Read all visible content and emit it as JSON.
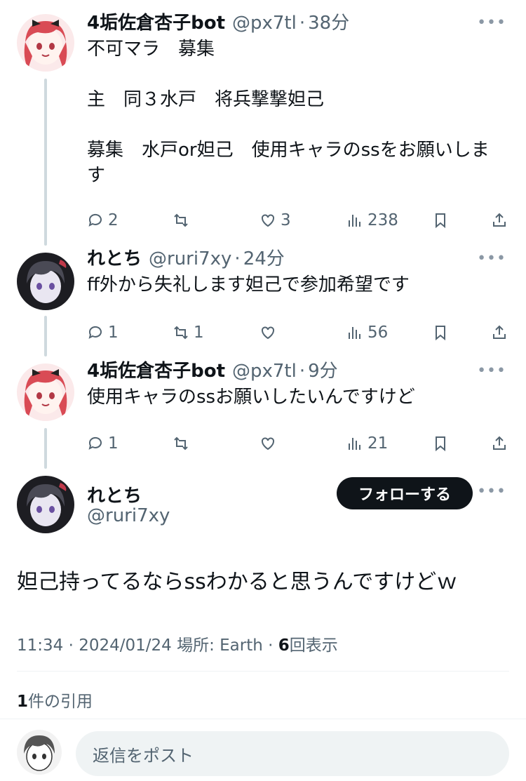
{
  "tweets": [
    {
      "name": "4垢佐倉杏子bot",
      "handle": "@px7tl",
      "time": "38分",
      "text": "不可マラ　募集\n\n主　同３水戸　将兵撃撃妲己\n\n募集　水戸or妲己　使用キャラのssをお願いしま\nす",
      "replies": "2",
      "retweets": "",
      "likes": "3",
      "views": "238"
    },
    {
      "name": "れとち",
      "handle": "@ruri7xy",
      "time": "24分",
      "text": "ff外から失礼します妲己で参加希望です",
      "replies": "1",
      "retweets": "1",
      "likes": "",
      "views": "56"
    },
    {
      "name": "4垢佐倉杏子bot",
      "handle": "@px7tl",
      "time": "9分",
      "text": "使用キャラのssお願いしたいんですけど",
      "replies": "1",
      "retweets": "",
      "likes": "",
      "views": "21"
    }
  ],
  "main_tweet": {
    "name": "れとち",
    "handle": "@ruri7xy",
    "follow_label": "フォローする",
    "text": "妲己持ってるならssわかると思うんですけどｗ",
    "meta_time": "11:34 · 2024/01/24 場所: Earth · ",
    "meta_views_count": "6",
    "meta_views_label": "回表示",
    "quotes_count": "1",
    "quotes_label": "件の引用"
  },
  "reply_box": {
    "placeholder": "返信をポスト"
  },
  "more_label": "•••",
  "colors": {
    "text": "#0f1419",
    "secondary": "#536471",
    "thread_line": "#cfd9de",
    "button_bg": "#0f1419"
  }
}
